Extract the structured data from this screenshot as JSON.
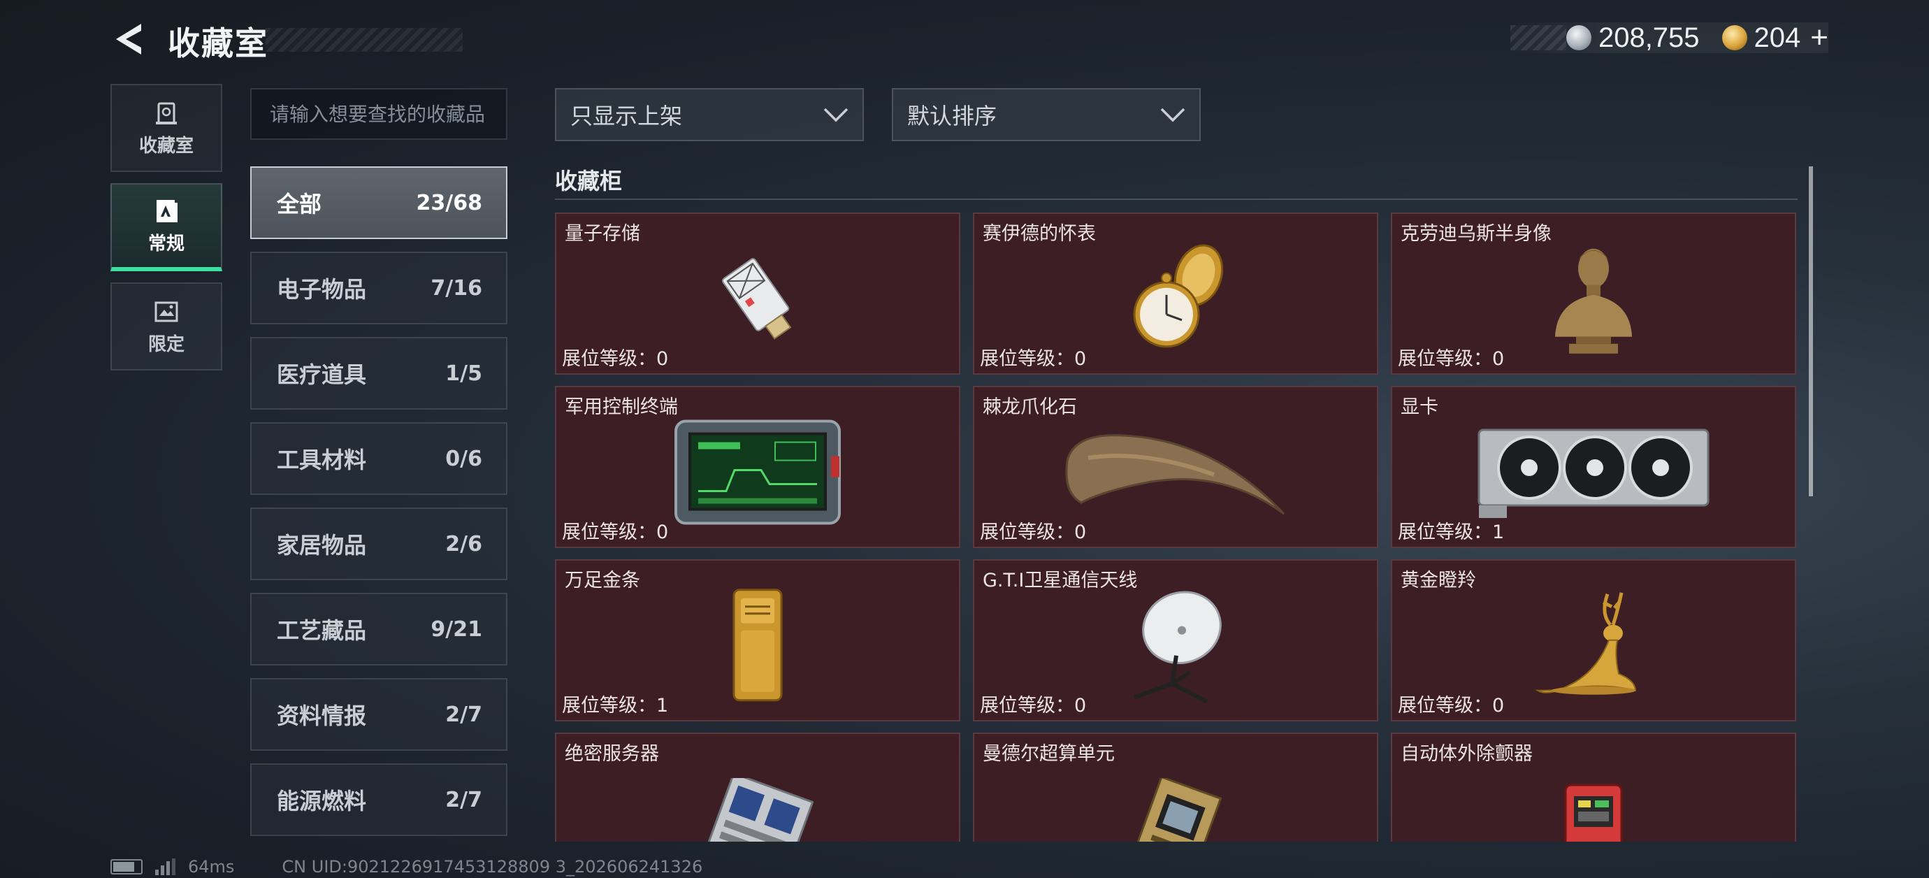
{
  "header": {
    "title": "收藏室",
    "currencies": [
      {
        "icon": "silver-coin-icon",
        "value": "208,755"
      },
      {
        "icon": "gold-coin-icon",
        "value": "204"
      }
    ],
    "add_label": "+"
  },
  "tabs": [
    {
      "label": "收藏室",
      "icon": "collection-room-icon",
      "active": false
    },
    {
      "label": "常规",
      "icon": "regular-icon",
      "active": true
    },
    {
      "label": "限定",
      "icon": "limited-icon",
      "active": false
    }
  ],
  "search": {
    "placeholder": "请输入想要查找的收藏品"
  },
  "categories": [
    {
      "name": "全部",
      "count": "23/68",
      "active": true
    },
    {
      "name": "电子物品",
      "count": "7/16"
    },
    {
      "name": "医疗道具",
      "count": "1/5"
    },
    {
      "name": "工具材料",
      "count": "0/6"
    },
    {
      "name": "家居物品",
      "count": "2/6"
    },
    {
      "name": "工艺藏品",
      "count": "9/21"
    },
    {
      "name": "资料情报",
      "count": "2/7"
    },
    {
      "name": "能源燃料",
      "count": "2/7"
    }
  ],
  "filters": {
    "display": "只显示上架",
    "sort": "默认排序"
  },
  "section": {
    "title": "收藏柜"
  },
  "level_prefix": "展位等级：",
  "items": [
    {
      "name": "量子存储",
      "level": "0",
      "icon": "usb-drive-icon"
    },
    {
      "name": "赛伊德的怀表",
      "level": "0",
      "icon": "pocket-watch-icon"
    },
    {
      "name": "克劳迪乌斯半身像",
      "level": "0",
      "icon": "bust-statue-icon"
    },
    {
      "name": "军用控制终端",
      "level": "0",
      "icon": "military-terminal-icon"
    },
    {
      "name": "棘龙爪化石",
      "level": "0",
      "icon": "claw-fossil-icon"
    },
    {
      "name": "显卡",
      "level": "1",
      "icon": "graphics-card-icon"
    },
    {
      "name": "万足金条",
      "level": "1",
      "icon": "gold-bar-icon"
    },
    {
      "name": "G.T.I卫星通信天线",
      "level": "0",
      "icon": "satellite-dish-icon"
    },
    {
      "name": "黄金瞪羚",
      "level": "0",
      "icon": "gold-gazelle-icon"
    },
    {
      "name": "绝密服务器",
      "level": "",
      "icon": "server-icon"
    },
    {
      "name": "曼德尔超算单元",
      "level": "",
      "icon": "supercomputer-unit-icon"
    },
    {
      "name": "自动体外除颤器",
      "level": "",
      "icon": "defibrillator-icon"
    }
  ],
  "footer": {
    "ping": "64ms",
    "uid": "CN UID:9021226917453128809 3_202606241326"
  }
}
